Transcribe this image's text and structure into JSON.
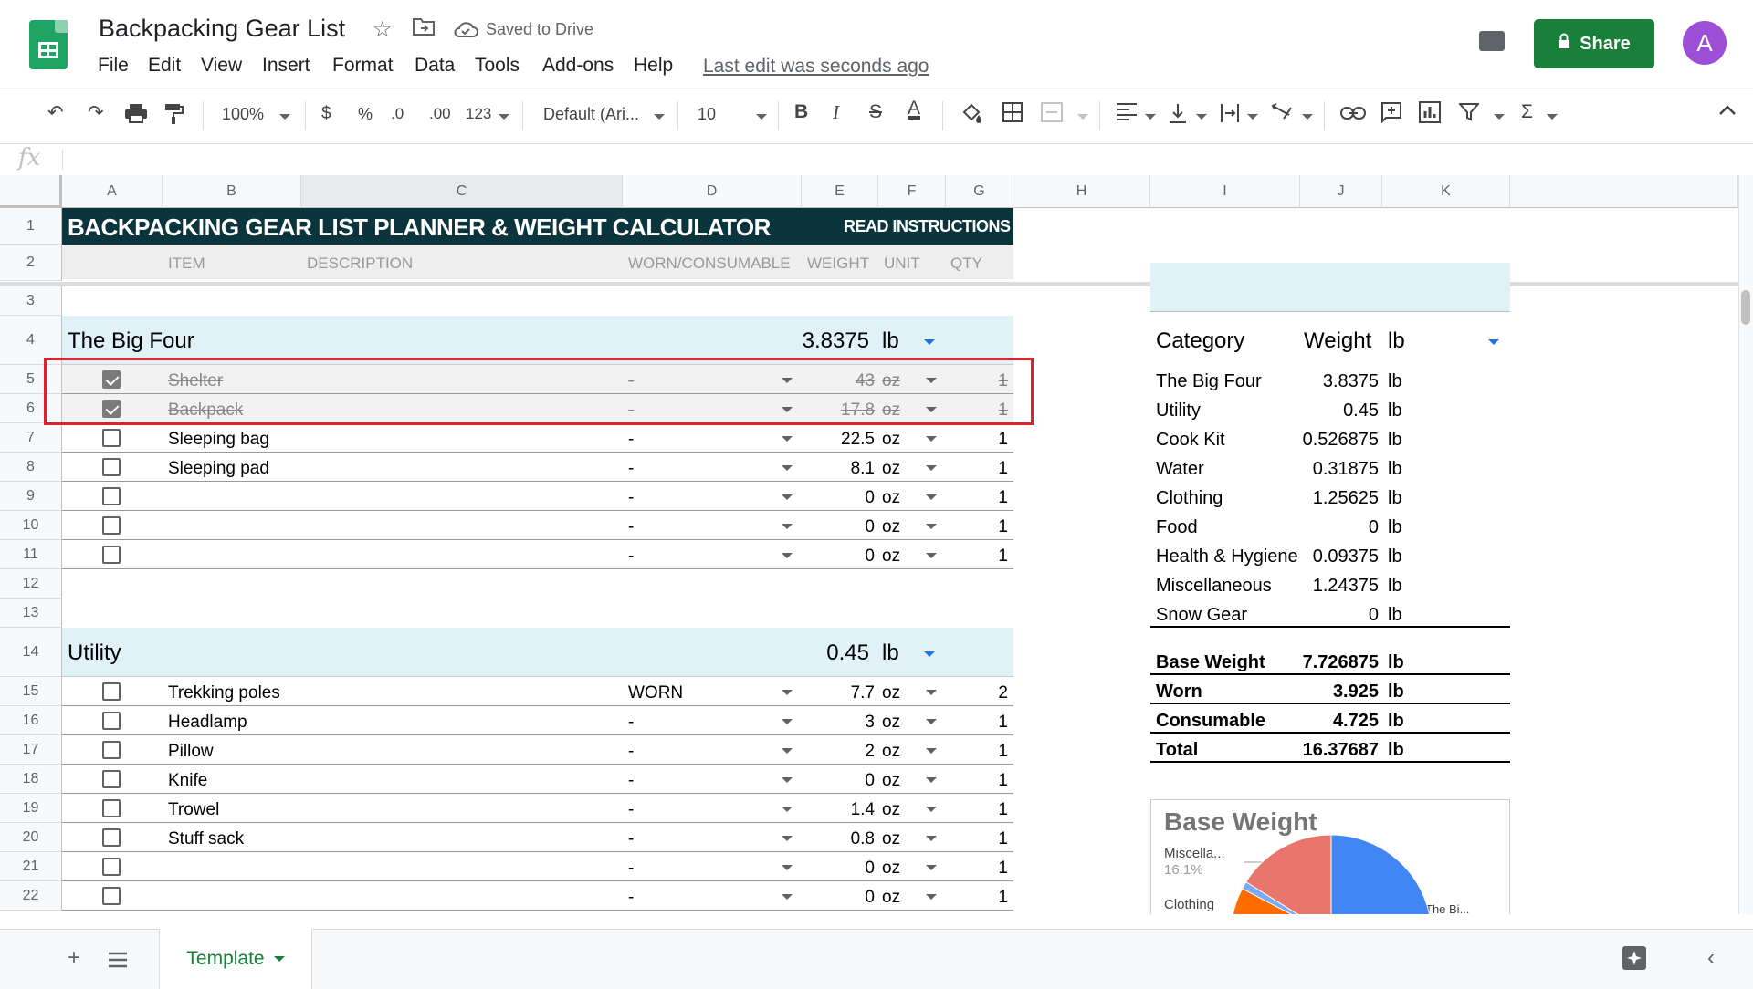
{
  "app": {
    "doc_title": "Backpacking Gear List",
    "saved_status": "Saved to Drive",
    "menu": [
      "File",
      "Edit",
      "View",
      "Insert",
      "Format",
      "Data",
      "Tools",
      "Add-ons",
      "Help"
    ],
    "last_edit": "Last edit was seconds ago",
    "share_label": "Share",
    "avatar_letter": "A"
  },
  "toolbar": {
    "zoom": "100%",
    "currency": "$",
    "percent": "%",
    "dec_decrease": ".0",
    "dec_increase": ".00",
    "more_formats": "123",
    "font": "Default (Ari...",
    "font_size": "10",
    "bold": "B",
    "italic": "I",
    "strike": "S",
    "text_color": "A"
  },
  "formula_bar": {
    "fx": "fx"
  },
  "columns": [
    "A",
    "B",
    "C",
    "D",
    "E",
    "F",
    "G",
    "H",
    "I",
    "J",
    "K"
  ],
  "rows": [
    "1",
    "2",
    "3",
    "4",
    "5",
    "6",
    "7",
    "8",
    "9",
    "10",
    "11",
    "12",
    "13",
    "14",
    "15",
    "16",
    "17",
    "18",
    "19",
    "20",
    "21",
    "22"
  ],
  "sheet": {
    "banner_title": "BACKPACKING GEAR LIST PLANNER & WEIGHT CALCULATOR",
    "read_instructions": "READ INSTRUCTIONS",
    "headers": {
      "item": "ITEM",
      "description": "DESCRIPTION",
      "worn": "WORN/CONSUMABLE",
      "weight": "WEIGHT",
      "unit": "UNIT",
      "qty": "QTY"
    },
    "big_four": {
      "name": "The Big Four",
      "total": "3.8375",
      "unit": "lb",
      "items": [
        {
          "checked": true,
          "item": "Shelter",
          "worn": "-",
          "weight": "43",
          "unit": "oz",
          "qty": "1"
        },
        {
          "checked": true,
          "item": "Backpack",
          "worn": "-",
          "weight": "17.8",
          "unit": "oz",
          "qty": "1"
        },
        {
          "checked": false,
          "item": "Sleeping bag",
          "worn": "-",
          "weight": "22.5",
          "unit": "oz",
          "qty": "1"
        },
        {
          "checked": false,
          "item": "Sleeping pad",
          "worn": "-",
          "weight": "8.1",
          "unit": "oz",
          "qty": "1"
        },
        {
          "checked": false,
          "item": "",
          "worn": "-",
          "weight": "0",
          "unit": "oz",
          "qty": "1"
        },
        {
          "checked": false,
          "item": "",
          "worn": "-",
          "weight": "0",
          "unit": "oz",
          "qty": "1"
        },
        {
          "checked": false,
          "item": "",
          "worn": "-",
          "weight": "0",
          "unit": "oz",
          "qty": "1"
        }
      ]
    },
    "utility": {
      "name": "Utility",
      "total": "0.45",
      "unit": "lb",
      "items": [
        {
          "checked": false,
          "item": "Trekking poles",
          "worn": "WORN",
          "weight": "7.7",
          "unit": "oz",
          "qty": "2"
        },
        {
          "checked": false,
          "item": "Headlamp",
          "worn": "-",
          "weight": "3",
          "unit": "oz",
          "qty": "1"
        },
        {
          "checked": false,
          "item": "Pillow",
          "worn": "-",
          "weight": "2",
          "unit": "oz",
          "qty": "1"
        },
        {
          "checked": false,
          "item": "Knife",
          "worn": "-",
          "weight": "0",
          "unit": "oz",
          "qty": "1"
        },
        {
          "checked": false,
          "item": "Trowel",
          "worn": "-",
          "weight": "1.4",
          "unit": "oz",
          "qty": "1"
        },
        {
          "checked": false,
          "item": "Stuff sack",
          "worn": "-",
          "weight": "0.8",
          "unit": "oz",
          "qty": "1"
        },
        {
          "checked": false,
          "item": "",
          "worn": "-",
          "weight": "0",
          "unit": "oz",
          "qty": "1"
        },
        {
          "checked": false,
          "item": "",
          "worn": "-",
          "weight": "0",
          "unit": "oz",
          "qty": "1"
        }
      ]
    }
  },
  "summary": {
    "header": {
      "category": "Category",
      "weight": "Weight",
      "unit": "lb"
    },
    "categories": [
      {
        "name": "The Big Four",
        "weight": "3.8375",
        "unit": "lb"
      },
      {
        "name": "Utility",
        "weight": "0.45",
        "unit": "lb"
      },
      {
        "name": "Cook Kit",
        "weight": "0.526875",
        "unit": "lb"
      },
      {
        "name": "Water",
        "weight": "0.31875",
        "unit": "lb"
      },
      {
        "name": "Clothing",
        "weight": "1.25625",
        "unit": "lb"
      },
      {
        "name": "Food",
        "weight": "0",
        "unit": "lb"
      },
      {
        "name": "Health & Hygiene",
        "weight": "0.09375",
        "unit": "lb"
      },
      {
        "name": "Miscellaneous",
        "weight": "1.24375",
        "unit": "lb"
      },
      {
        "name": "Snow Gear",
        "weight": "0",
        "unit": "lb"
      }
    ],
    "totals": [
      {
        "name": "Base Weight",
        "weight": "7.726875",
        "unit": "lb"
      },
      {
        "name": "Worn",
        "weight": "3.925",
        "unit": "lb"
      },
      {
        "name": "Consumable",
        "weight": "4.725",
        "unit": "lb"
      },
      {
        "name": "Total",
        "weight": "16.37687",
        "unit": "lb"
      }
    ]
  },
  "chart": {
    "title": "Base Weight",
    "label_misc": "Miscella...",
    "label_misc_pct": "16.1%",
    "label_clothing": "Clothing",
    "label_bigfour": "The Bi..."
  },
  "chart_data": {
    "type": "pie",
    "title": "Base Weight",
    "categories": [
      "The Big Four",
      "Utility",
      "Cook Kit",
      "Water",
      "Clothing",
      "Food",
      "Health & Hygiene",
      "Miscellaneous",
      "Snow Gear"
    ],
    "values": [
      3.8375,
      0.45,
      0.526875,
      0.31875,
      1.25625,
      0,
      0.09375,
      1.24375,
      0
    ],
    "colors": {
      "big_four": "#4285f4",
      "misc": "#e8766c",
      "clothing": "#ff6d01",
      "thin": "#7baaf7"
    }
  },
  "tabs": {
    "sheet_name": "Template"
  },
  "colors": {
    "banner": "#0c343d",
    "section": "#e0f2f7",
    "share": "#188038",
    "highlight": "#e0202a",
    "avatar": "#9c4fd6"
  }
}
